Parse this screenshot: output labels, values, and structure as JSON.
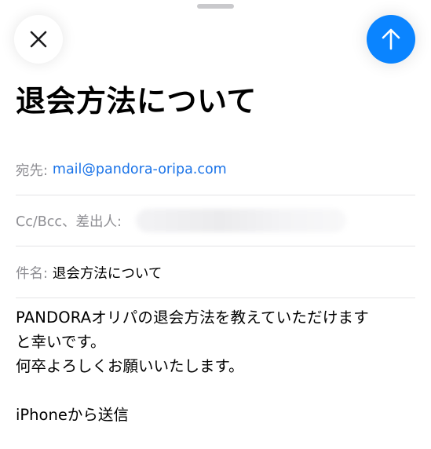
{
  "compose": {
    "title": "退会方法について",
    "to_label": "宛先",
    "to_address": "mail@pandora-oripa.com",
    "cc_label": "Cc/Bcc、差出人",
    "subject_label": "件名",
    "subject_value": "退会方法について",
    "body_line1": "PANDORAオリパの退会方法を教えていただけます",
    "body_line2": "と幸いです。",
    "body_line3": "何卒よろしくお願いいたします。",
    "signature": "iPhoneから送信"
  },
  "icons": {
    "close": "close-icon",
    "send": "arrow-up-icon"
  },
  "colors": {
    "accent": "#0a84ff",
    "link": "#1a73e8",
    "label": "#8e8e93"
  }
}
